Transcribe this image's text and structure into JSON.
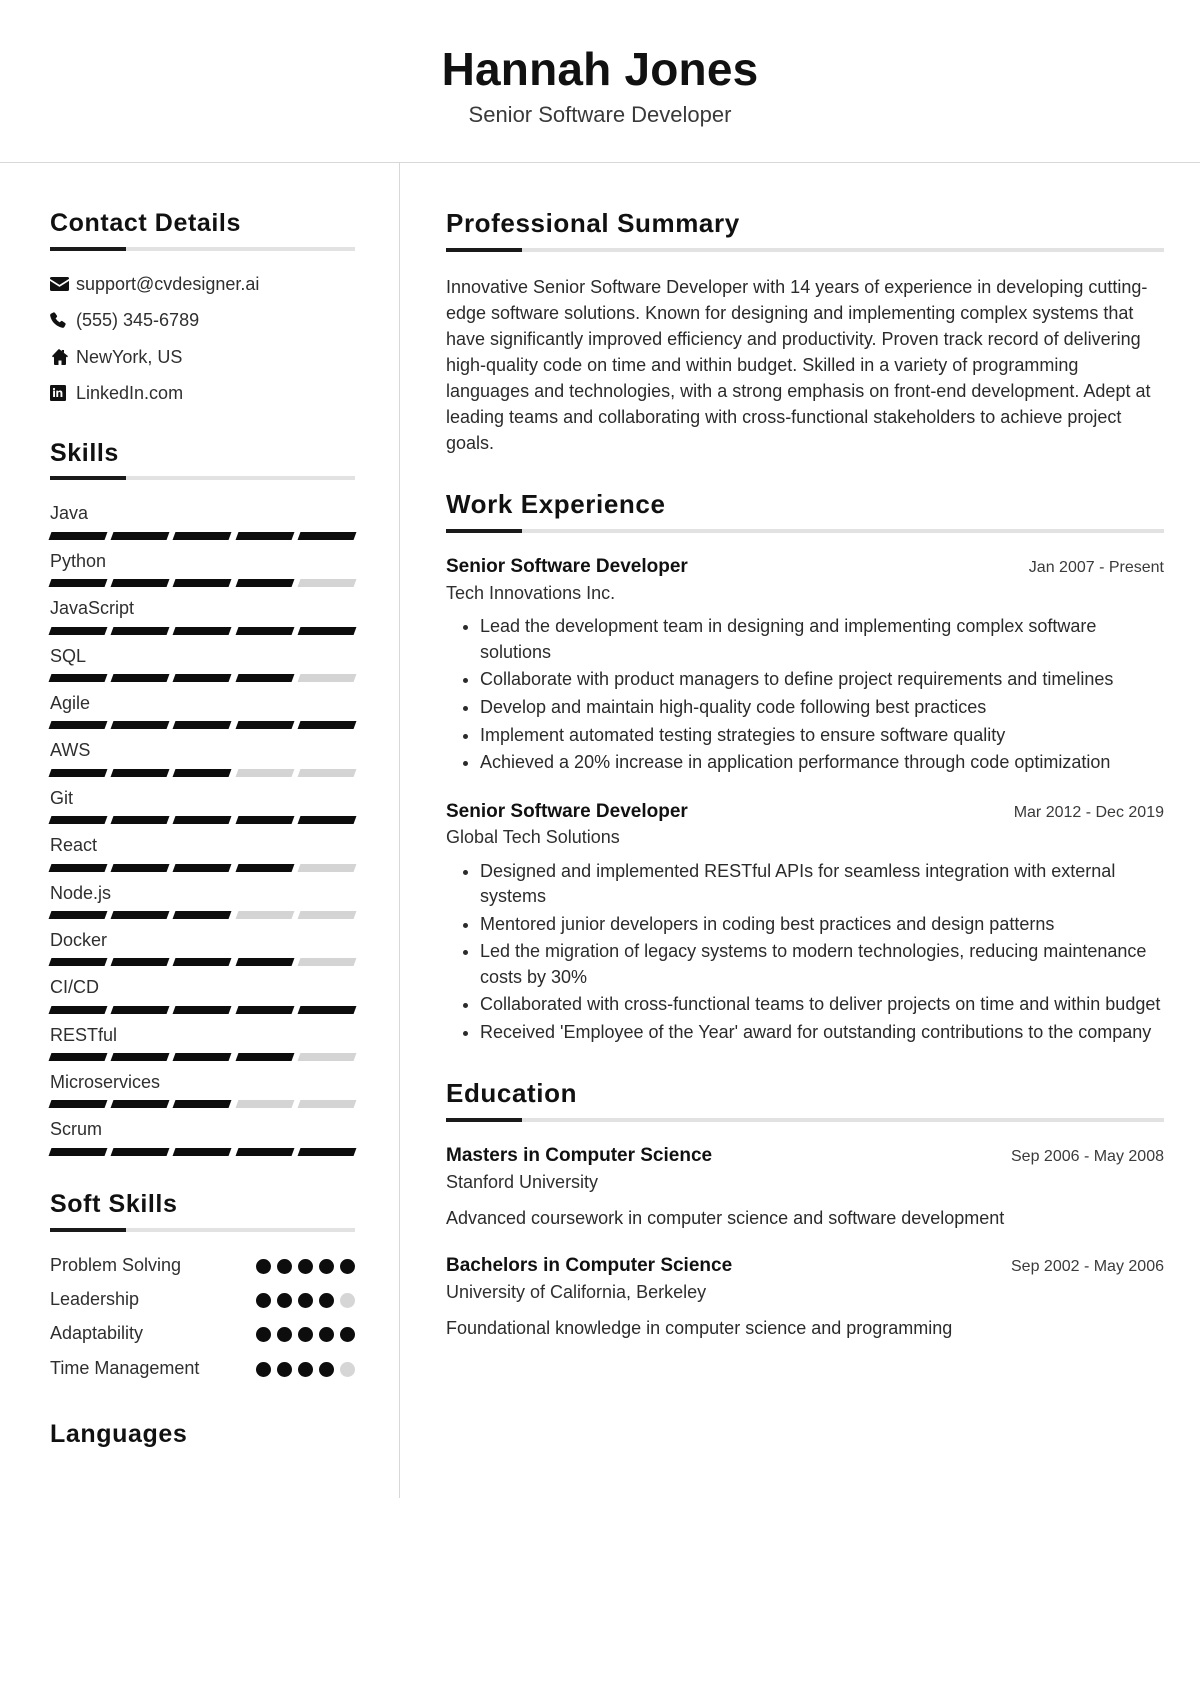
{
  "header": {
    "full_name": "Hannah Jones",
    "job_title": "Senior Software Developer"
  },
  "sidebar": {
    "contact": {
      "title": "Contact Details",
      "items": [
        {
          "icon": "envelope-icon",
          "text": "support@cvdesigner.ai"
        },
        {
          "icon": "phone-icon",
          "text": "(555) 345-6789"
        },
        {
          "icon": "home-icon",
          "text": "NewYork, US"
        },
        {
          "icon": "linkedin-icon",
          "text": "LinkedIn.com"
        }
      ]
    },
    "skills": {
      "title": "Skills",
      "max": 5,
      "items": [
        {
          "name": "Java",
          "level": 5
        },
        {
          "name": "Python",
          "level": 4
        },
        {
          "name": "JavaScript",
          "level": 5
        },
        {
          "name": "SQL",
          "level": 4
        },
        {
          "name": "Agile",
          "level": 5
        },
        {
          "name": "AWS",
          "level": 3
        },
        {
          "name": "Git",
          "level": 5
        },
        {
          "name": "React",
          "level": 4
        },
        {
          "name": "Node.js",
          "level": 3
        },
        {
          "name": "Docker",
          "level": 4
        },
        {
          "name": "CI/CD",
          "level": 5
        },
        {
          "name": "RESTful",
          "level": 4
        },
        {
          "name": "Microservices",
          "level": 3
        },
        {
          "name": "Scrum",
          "level": 5
        }
      ]
    },
    "soft_skills": {
      "title": "Soft Skills",
      "max": 5,
      "items": [
        {
          "name": "Problem Solving",
          "level": 5
        },
        {
          "name": "Leadership",
          "level": 4
        },
        {
          "name": "Adaptability",
          "level": 5
        },
        {
          "name": "Time Management",
          "level": 4
        }
      ]
    },
    "languages": {
      "title": "Languages"
    }
  },
  "main": {
    "summary": {
      "title": "Professional Summary",
      "text": "Innovative Senior Software Developer with 14 years of experience in developing cutting-edge software solutions. Known for designing and implementing complex systems that have significantly improved efficiency and productivity. Proven track record of delivering high-quality code on time and within budget. Skilled in a variety of programming languages and technologies, with a strong emphasis on front-end development. Adept at leading teams and collaborating with cross-functional stakeholders to achieve project goals."
    },
    "work": {
      "title": "Work Experience",
      "entries": [
        {
          "role": "Senior Software Developer",
          "date": "Jan 2007 - Present",
          "org": "Tech Innovations Inc.",
          "bullets": [
            "Lead the development team in designing and implementing complex software solutions",
            "Collaborate with product managers to define project requirements and timelines",
            "Develop and maintain high-quality code following best practices",
            "Implement automated testing strategies to ensure software quality",
            "Achieved a 20% increase in application performance through code optimization"
          ]
        },
        {
          "role": "Senior Software Developer",
          "date": "Mar 2012 - Dec 2019",
          "org": "Global Tech Solutions",
          "bullets": [
            "Designed and implemented RESTful APIs for seamless integration with external systems",
            "Mentored junior developers in coding best practices and design patterns",
            "Led the migration of legacy systems to modern technologies, reducing maintenance costs by 30%",
            "Collaborated with cross-functional teams to deliver projects on time and within budget",
            "Received 'Employee of the Year' award for outstanding contributions to the company"
          ]
        }
      ]
    },
    "education": {
      "title": "Education",
      "entries": [
        {
          "degree": "Masters in Computer Science",
          "date": "Sep 2006 - May 2008",
          "school": "Stanford University",
          "description": "Advanced coursework in computer science and software development"
        },
        {
          "degree": "Bachelors in Computer Science",
          "date": "Sep 2002 - May 2006",
          "school": "University of California, Berkeley",
          "description": "Foundational knowledge in computer science and programming"
        }
      ]
    }
  }
}
